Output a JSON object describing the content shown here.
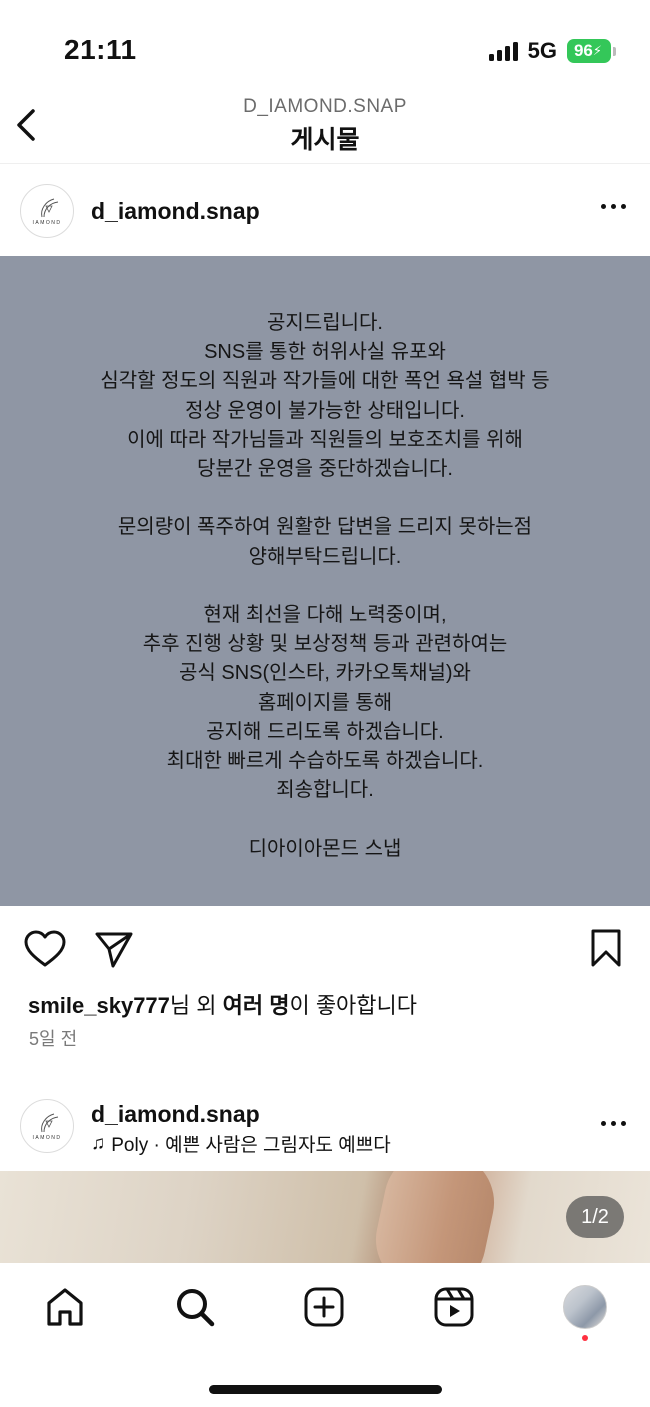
{
  "status_bar": {
    "time": "21:11",
    "network": "5G",
    "battery": "96"
  },
  "header": {
    "username": "D_IAMOND.SNAP",
    "title": "게시물"
  },
  "post": {
    "username": "d_iamond.snap",
    "avatar_logo_text": "IAMOND",
    "notice_lines": [
      "공지드립니다.",
      "SNS를 통한 허위사실 유포와",
      "심각할 정도의 직원과 작가들에 대한 폭언 욕설 협박 등",
      "정상 운영이 불가능한 상태입니다.",
      "이에 따라 작가님들과 직원들의 보호조치를 위해",
      "당분간 운영을 중단하겠습니다.",
      "",
      "문의량이 폭주하여 원활한 답변을 드리지 못하는점",
      "양해부탁드립니다.",
      "",
      "현재 최선을 다해 노력중이며,",
      "추후 진행 상황 및 보상정책 등과 관련하여는",
      "공식 SNS(인스타, 카카오톡채널)와",
      "홈페이지를 통해",
      "공지해 드리도록 하겠습니다.",
      "최대한 빠르게 수습하도록 하겠습니다.",
      "죄송합니다.",
      "",
      "디아이아몬드 스냅"
    ],
    "likes": {
      "user": "smile_sky777",
      "mid": "님 외 ",
      "bold": "여러 명",
      "tail": "이 좋아합니다"
    },
    "date": "5일 전"
  },
  "post2": {
    "username": "d_iamond.snap",
    "avatar_logo_text": "IAMOND",
    "music": "Poly · 예쁜 사람은 그림자도 예쁘다",
    "page_counter": "1/2"
  },
  "colors": {
    "notice_bg": "#8f96a4",
    "battery": "#34c759",
    "notification": "#ff3040"
  },
  "icons": {
    "header": [
      "back-icon"
    ],
    "post_actions": [
      "heart-icon",
      "send-icon",
      "bookmark-icon"
    ],
    "tab_bar": [
      "home-icon",
      "search-icon",
      "create-icon",
      "reels-icon",
      "profile-avatar"
    ]
  }
}
